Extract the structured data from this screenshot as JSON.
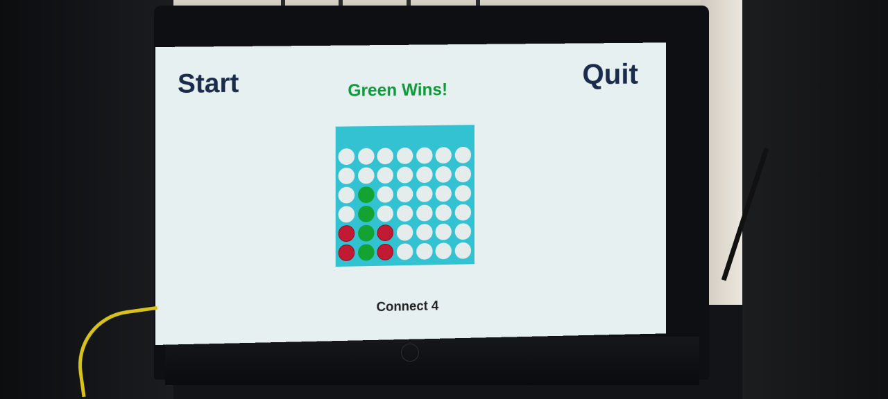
{
  "game": {
    "start_label": "Start",
    "quit_label": "Quit",
    "status_text": "Green Wins!",
    "title": "Connect 4",
    "colors": {
      "screen_background": "#e6f0f0",
      "board": "#33c2d1",
      "empty": "#e4ecec",
      "green": "#12a332",
      "red": "#c21a32",
      "button_text": "#1a2b4c",
      "status_text": "#0d9a3a"
    }
  },
  "board": {
    "columns": 7,
    "rows": 6,
    "cells": [
      [
        "empty",
        "empty",
        "empty",
        "empty",
        "empty",
        "empty",
        "empty"
      ],
      [
        "empty",
        "empty",
        "empty",
        "empty",
        "empty",
        "empty",
        "empty"
      ],
      [
        "empty",
        "green",
        "empty",
        "empty",
        "empty",
        "empty",
        "empty"
      ],
      [
        "empty",
        "green",
        "empty",
        "empty",
        "empty",
        "empty",
        "empty"
      ],
      [
        "red",
        "green",
        "red",
        "empty",
        "empty",
        "empty",
        "empty"
      ],
      [
        "red",
        "green",
        "red",
        "empty",
        "empty",
        "empty",
        "empty"
      ]
    ]
  }
}
